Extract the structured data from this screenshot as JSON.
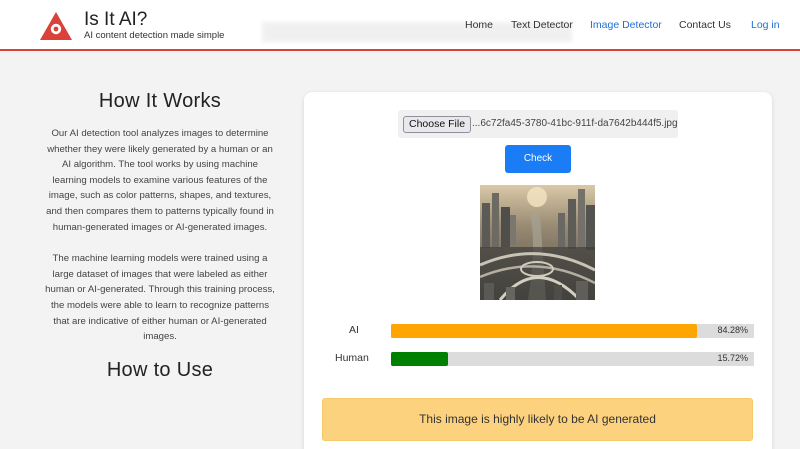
{
  "header": {
    "brand_title": "Is It AI?",
    "brand_tagline": "AI content detection made simple",
    "nav": {
      "home": "Home",
      "text_detector": "Text Detector",
      "image_detector": "Image Detector",
      "contact": "Contact Us",
      "login": "Log in"
    },
    "logo_icon": "triangle-a-logo-icon"
  },
  "how_it_works": {
    "title": "How It Works",
    "paragraph_1": "Our AI detection tool analyzes images to determine whether they were likely generated by a human or an AI algorithm. The tool works by using machine learning models to examine various features of the image, such as color patterns, shapes, and textures, and then compares them to patterns typically found in human-generated images or AI-generated images.",
    "paragraph_2": "The machine learning models were trained using a large dataset of images that were labeled as either human or AI-generated. Through this training process, the models were able to learn to recognize patterns that are indicative of either human or AI-generated images."
  },
  "how_to_use": {
    "title": "How to Use"
  },
  "detector": {
    "file_button": "Choose File",
    "file_name": "...6c72fa45-3780-41bc-911f-da7642b444f5.jpg",
    "check_button": "Check",
    "results": [
      {
        "label": "AI",
        "percent_text": "84.28%",
        "fraction": 0.8428,
        "color": "#ffa500"
      },
      {
        "label": "Human",
        "percent_text": "15.72%",
        "fraction": 0.1572,
        "color": "#008000"
      }
    ],
    "verdict": "This image is highly likely to be AI generated"
  },
  "colors": {
    "accent_red": "#d9413a",
    "link_blue": "#1f6fd6",
    "button_blue": "#1a7df5",
    "verdict_bg": "#fdd27e"
  }
}
